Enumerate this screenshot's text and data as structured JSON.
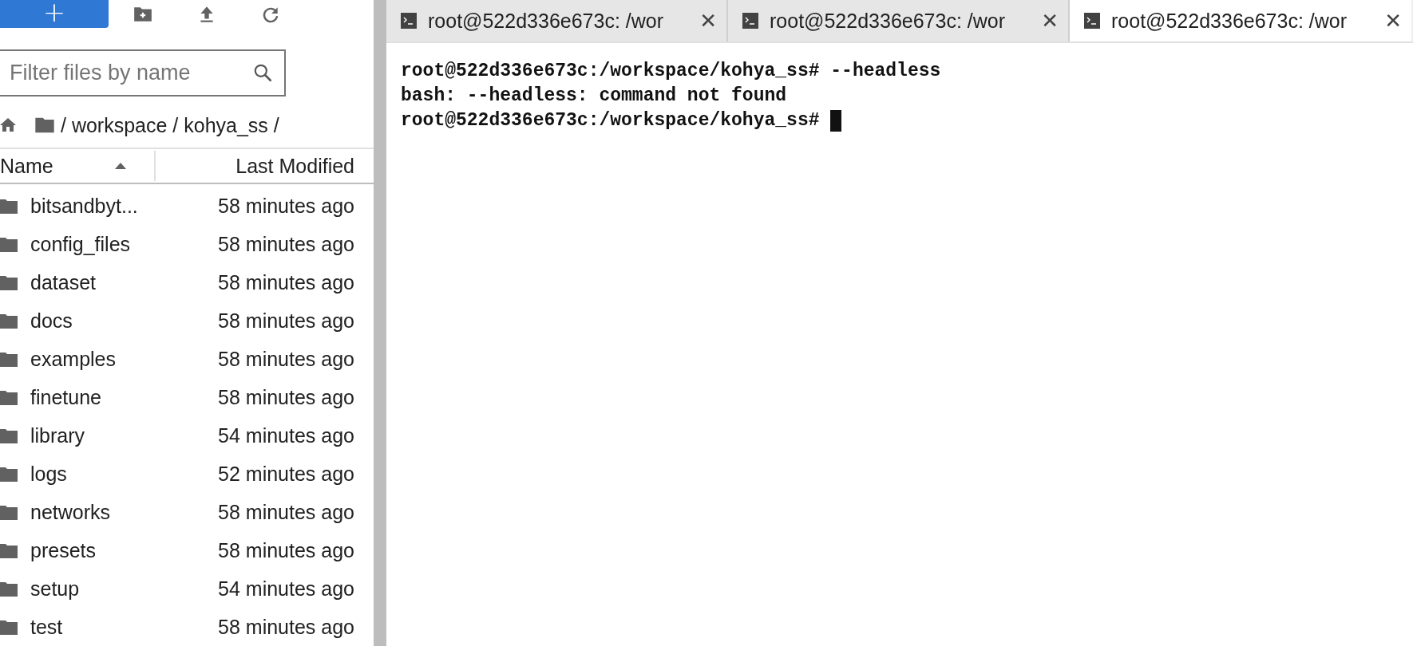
{
  "toolbar": {
    "buttons": [
      {
        "kind": "new",
        "label": "+"
      },
      {
        "kind": "new-folder"
      },
      {
        "kind": "upload"
      },
      {
        "kind": "refresh"
      }
    ]
  },
  "filter": {
    "placeholder": "Filter files by name"
  },
  "breadcrumb": {
    "parts": [
      "/ workspace / kohya_ss /"
    ]
  },
  "file_table": {
    "columns": [
      {
        "label": "Name",
        "sorted": true
      },
      {
        "label": "Last Modified",
        "sorted": false
      }
    ],
    "rows": [
      {
        "name": "bitsandbyt...",
        "modified": "58 minutes ago",
        "kind": "folder"
      },
      {
        "name": "config_files",
        "modified": "58 minutes ago",
        "kind": "folder"
      },
      {
        "name": "dataset",
        "modified": "58 minutes ago",
        "kind": "folder"
      },
      {
        "name": "docs",
        "modified": "58 minutes ago",
        "kind": "folder"
      },
      {
        "name": "examples",
        "modified": "58 minutes ago",
        "kind": "folder"
      },
      {
        "name": "finetune",
        "modified": "58 minutes ago",
        "kind": "folder"
      },
      {
        "name": "library",
        "modified": "54 minutes ago",
        "kind": "folder"
      },
      {
        "name": "logs",
        "modified": "52 minutes ago",
        "kind": "folder"
      },
      {
        "name": "networks",
        "modified": "58 minutes ago",
        "kind": "folder"
      },
      {
        "name": "presets",
        "modified": "58 minutes ago",
        "kind": "folder"
      },
      {
        "name": "setup",
        "modified": "54 minutes ago",
        "kind": "folder"
      },
      {
        "name": "test",
        "modified": "58 minutes ago",
        "kind": "folder"
      }
    ]
  },
  "tabs": [
    {
      "label": "root@522d336e673c: /wor",
      "close": "✕",
      "selected": false
    },
    {
      "label": "root@522d336e673c: /wor",
      "close": "✕",
      "selected": false
    },
    {
      "label": "root@522d336e673c: /wor",
      "close": "✕",
      "selected": true
    }
  ],
  "terminal": {
    "lines": [
      "root@522d336e673c:/workspace/kohya_ss# --headless",
      "bash: --headless: command not found",
      "root@522d336e673c:/workspace/kohya_ss# "
    ],
    "cursor": true
  }
}
